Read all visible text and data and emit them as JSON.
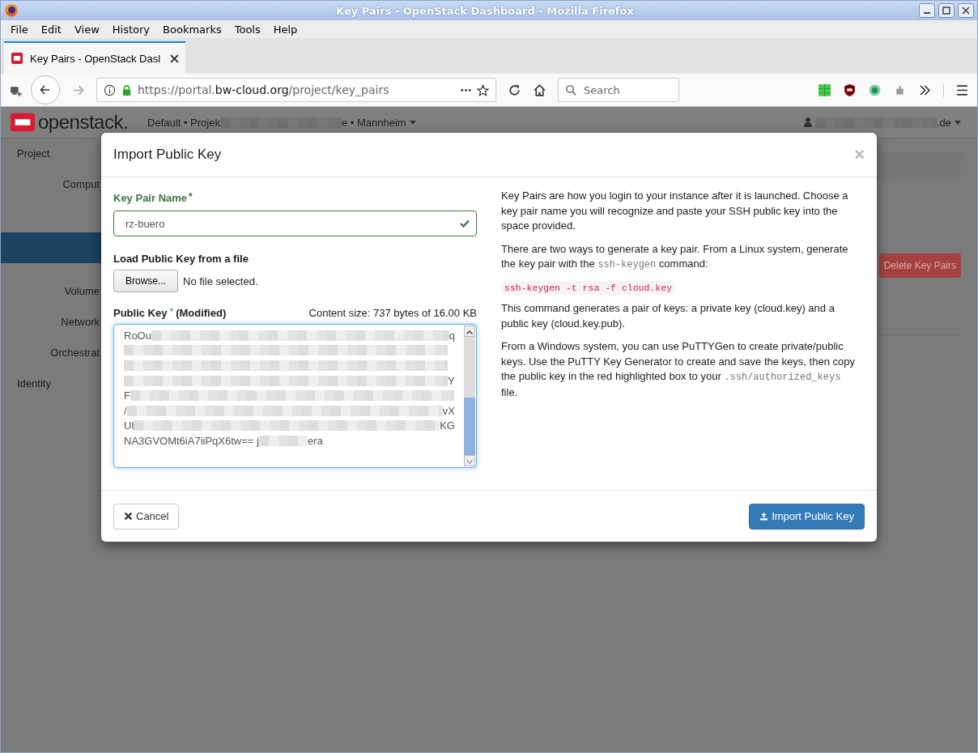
{
  "window": {
    "title": "Key Pairs - OpenStack Dashboard - Mozilla Firefox"
  },
  "menu": [
    "File",
    "Edit",
    "View",
    "History",
    "Bookmarks",
    "Tools",
    "Help"
  ],
  "tab": {
    "title": "Key Pairs - OpenStack Dasl"
  },
  "url": {
    "prefix": "https://portal.",
    "domain": "bw-cloud.org",
    "path": "/project/key_pairs"
  },
  "search": {
    "placeholder": "Search"
  },
  "header": {
    "logo": "openstack.",
    "project_start": "Default • Projek",
    "project_end": "e • Mannheim",
    "user_end": ".de"
  },
  "sidebar": [
    {
      "label": "Project",
      "kind": "heading",
      "selected": false
    },
    {
      "label": "Comput",
      "kind": "item",
      "selected": false
    },
    {
      "kind": "blank",
      "selected": true
    },
    {
      "label": "Volume",
      "kind": "item",
      "selected": false
    },
    {
      "label": "Network",
      "kind": "item",
      "selected": false
    },
    {
      "label": "Orchestrat",
      "kind": "item",
      "selected": false
    },
    {
      "label": "Identity",
      "kind": "heading",
      "selected": false
    }
  ],
  "background_button": "Delete Key Pairs",
  "modal": {
    "title": "Import Public Key",
    "close": "×",
    "name_label": "Key Pair Name",
    "required_mark": "*",
    "name_value": "rz-buero",
    "name_valid": true,
    "file_label": "Load Public Key from a file",
    "browse": "Browse...",
    "no_file": "No file selected.",
    "key_label": "Public Key",
    "key_modified": "(Modified)",
    "content_size": "Content size: 737 bytes of 16.00 KB",
    "key_lines": [
      {
        "start": "RoOu",
        "end": "q"
      },
      {
        "blurred": true
      },
      {
        "blurred": true
      },
      {
        "end": "Y"
      },
      {
        "start": "F"
      },
      {
        "start": "/",
        "end": "vX"
      },
      {
        "start": "Ul",
        "end": "KG"
      },
      {
        "start": "NA3GVOMt6iA7iiPqX6tw== j",
        "end": "era"
      }
    ],
    "help": [
      {
        "kind": "text",
        "text": "Key Pairs are how you login to your instance after it is launched. Choose a key pair name you will recognize and paste your SSH public key into the space provided."
      },
      {
        "kind": "text",
        "text": "There are two ways to generate a key pair. From a Linux system, generate the key pair with the ",
        "code": "ssh-keygen",
        "after": " command:"
      },
      {
        "kind": "command",
        "text": "ssh-keygen -t rsa -f cloud.key"
      },
      {
        "kind": "text",
        "text": "This command generates a pair of keys: a private key (cloud.key) and a public key (cloud.key.pub)."
      },
      {
        "kind": "text",
        "text": "From a Windows system, you can use PuTTYGen to create private/public keys. Use the PuTTY Key Generator to create and save the keys, then copy the public key in the red highlighted box to your ",
        "code": ".ssh/authorized_keys",
        "after": " file."
      }
    ],
    "cancel": "Cancel",
    "submit": "Import Public Key"
  }
}
